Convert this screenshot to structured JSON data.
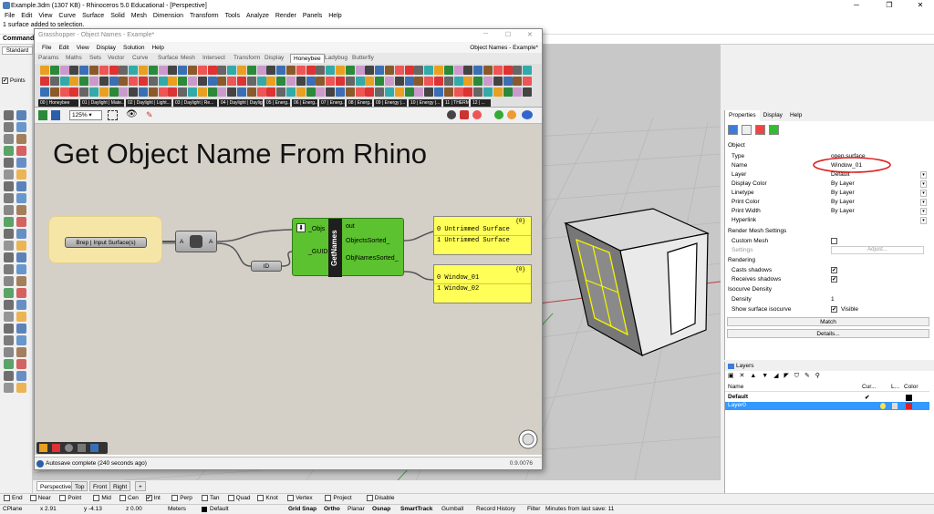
{
  "window": {
    "title": "Example.3dm (1307 KB) - Rhinoceros 5.0 Educational - [Perspective]"
  },
  "menu": [
    "File",
    "Edit",
    "View",
    "Curve",
    "Surface",
    "Solid",
    "Mesh",
    "Dimension",
    "Transform",
    "Tools",
    "Analyze",
    "Render",
    "Panels",
    "Help"
  ],
  "command": {
    "history": "1 surface added to selection.",
    "prompt": "Command:"
  },
  "left_toolbar": {
    "tab": "Standard",
    "points_label": "Points"
  },
  "grasshopper": {
    "title": "Grasshopper - Object Names - Example*",
    "menu": [
      "File",
      "Edit",
      "View",
      "Display",
      "Solution",
      "Help"
    ],
    "doc_name": "Object Names - Example*",
    "tabs": [
      "Params",
      "Maths",
      "Sets",
      "Vector",
      "Curve",
      "Surface",
      "Mesh",
      "Intersect",
      "Transform",
      "Display",
      "Honeybee",
      "Ladybug",
      "Butterfly"
    ],
    "active_tab": "Honeybee",
    "ribbon_groups": [
      "00 | Honeybee",
      "01 | Daylight | Mate...",
      "02 | Daylight | Light...",
      "03 | Daylight | Re...",
      "04 | Daylight | Daylig...",
      "05 | Energ...",
      "06 | Energ...",
      "07 | Energ...",
      "08 | Energ...",
      "09 | Energy |...",
      "10 | Energy |...",
      "11 | THERM",
      "12 | ..."
    ],
    "zoom": "125%",
    "canvas_title": "Get Object Name From Rhino",
    "nodes": {
      "brep": "Brep | Input Surface(s)",
      "relay_a_in": "A",
      "relay_a_out": "A",
      "id": "ID",
      "getnames_label": "GetNames",
      "getnames_in_1": "_Objs",
      "getnames_in_2": "_GUID",
      "getnames_out_1": "out",
      "getnames_out_2": "ObjectsSorted_",
      "getnames_out_3": "ObjNamesSorted_"
    },
    "panel1": {
      "header": "{0}",
      "rows": [
        {
          "idx": "0",
          "val": "Untrimmed Surface"
        },
        {
          "idx": "1",
          "val": "Untrimmed Surface"
        }
      ]
    },
    "panel2": {
      "header": "{0}",
      "rows": [
        {
          "idx": "0",
          "val": "Window_01"
        },
        {
          "idx": "1",
          "val": "Window_02"
        }
      ]
    },
    "status": "Autosave complete (240 seconds ago)",
    "version": "0.9.0076"
  },
  "properties": {
    "tabs": [
      "Properties",
      "Display",
      "Help"
    ],
    "section_object": "Object",
    "rows": [
      {
        "k": "Type",
        "v": "open surface"
      },
      {
        "k": "Name",
        "v": "Window_01"
      },
      {
        "k": "Layer",
        "v": "Default"
      },
      {
        "k": "Display Color",
        "v": "By Layer"
      },
      {
        "k": "Linetype",
        "v": "By Layer"
      },
      {
        "k": "Print Color",
        "v": "By Layer"
      },
      {
        "k": "Print Width",
        "v": "By Layer"
      },
      {
        "k": "Hyperlink",
        "v": ""
      }
    ],
    "render_mesh_section": "Render Mesh Settings",
    "custom_mesh": "Custom Mesh",
    "settings": "Settings",
    "adjust": "Adjust...",
    "rendering_section": "Rendering",
    "casts_shadows": "Casts shadows",
    "receives_shadows": "Receives shadows",
    "isocurve_section": "Isocurve Density",
    "density_label": "Density",
    "density_value": "1",
    "show_isocurve": "Show surface isocurve",
    "visible": "Visible",
    "match": "Match",
    "details": "Details..."
  },
  "layers": {
    "title": "Layers",
    "col_name": "Name",
    "col_current": "Cur...",
    "col_lock": "L...",
    "col_color": "Color",
    "rows": [
      {
        "name": "Default",
        "check": "✔"
      },
      {
        "name": "Layer0",
        "check": ""
      }
    ]
  },
  "viewport_tabs": [
    "Perspective",
    "Top",
    "Front",
    "Right"
  ],
  "osnaps": [
    {
      "label": "End",
      "checked": false
    },
    {
      "label": "Near",
      "checked": false
    },
    {
      "label": "Point",
      "checked": false
    },
    {
      "label": "Mid",
      "checked": false
    },
    {
      "label": "Cen",
      "checked": false
    },
    {
      "label": "Int",
      "checked": true
    },
    {
      "label": "Perp",
      "checked": false
    },
    {
      "label": "Tan",
      "checked": false
    },
    {
      "label": "Quad",
      "checked": false
    },
    {
      "label": "Knot",
      "checked": false
    },
    {
      "label": "Vertex",
      "checked": false
    },
    {
      "label": "Project",
      "checked": false
    },
    {
      "label": "Disable",
      "checked": false
    }
  ],
  "status": {
    "cplane": "CPlane",
    "x": "x 2.91",
    "y": "y -4.13",
    "z": "z 0.00",
    "units": "Meters",
    "layer": "Default",
    "toggles": [
      "Grid Snap",
      "Ortho",
      "Planar",
      "Osnap",
      "SmartTrack",
      "Gumball",
      "Record History",
      "Filter"
    ],
    "message": "Minutes from last save: 11"
  },
  "colors": {
    "node_green": "#5cc22f",
    "panel_yellow": "#ffff57",
    "group_yellow": "#f5e6a8",
    "selection_blue": "#3399ff",
    "highlight_red": "#e02020"
  }
}
